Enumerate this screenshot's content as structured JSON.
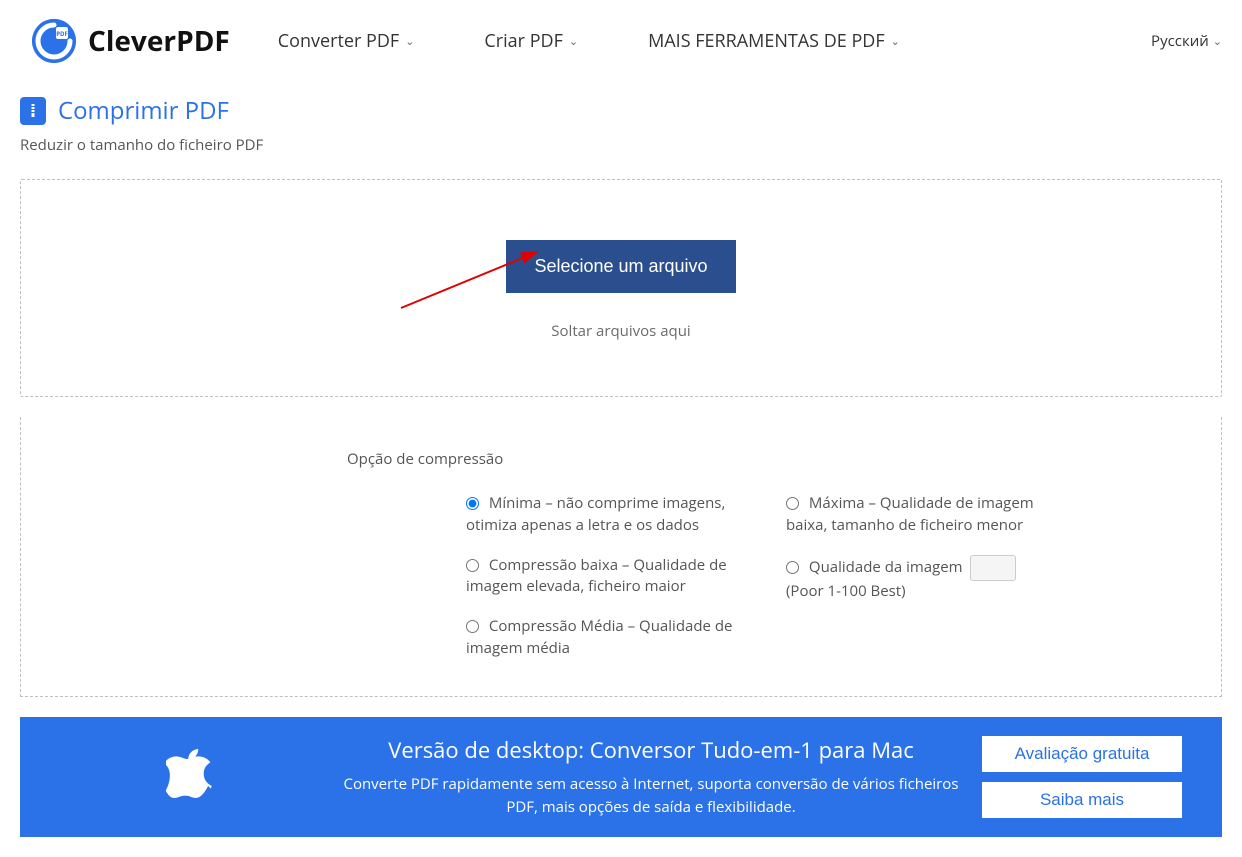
{
  "header": {
    "brand": "CleverPDF",
    "nav": {
      "convert": "Converter PDF",
      "create": "Criar PDF",
      "more": "MAIS FERRAMENTAS DE PDF"
    },
    "language": "Русский"
  },
  "page": {
    "title": "Comprimir PDF",
    "subtitle": "Reduzir o tamanho do ficheiro PDF"
  },
  "dropzone": {
    "select_button": "Selecione um arquivo",
    "drop_text": "Soltar arquivos aqui"
  },
  "options": {
    "heading": "Opção de compressão",
    "minima": "Mínima – não comprime imagens, otimiza apenas a letra e os dados",
    "baixa": "Compressão baixa – Qualidade de imagem elevada, ficheiro maior",
    "media": "Compressão Média – Qualidade de imagem média",
    "maxima": "Máxima – Qualidade de imagem baixa, tamanho de ficheiro menor",
    "qualidade_prefix": "Qualidade da imagem",
    "qualidade_suffix": "(Poor 1-100 Best)",
    "qualidade_value": ""
  },
  "promo": {
    "title": "Versão de desktop: Conversor Tudo-em-1 para Mac",
    "desc": "Converte PDF rapidamente sem acesso à Internet, suporta conversão de vários ficheiros PDF, mais opções de saída e flexibilidade.",
    "trial_button": "Avaliação gratuita",
    "learn_button": "Saiba mais"
  }
}
